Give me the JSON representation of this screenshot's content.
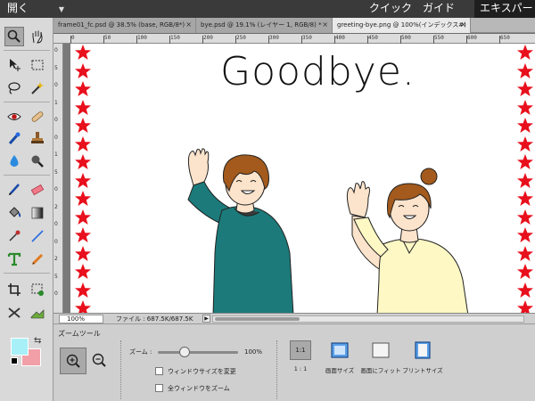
{
  "topbar": {
    "open_label": "開く",
    "modes": {
      "quick": "クイック",
      "guide": "ガイド",
      "expert": "エキスパート"
    }
  },
  "tabs": [
    {
      "label": "frame01_fc.psd @ 38.5% (base, RGB/8*)"
    },
    {
      "label": "bye.psd @ 19.1% (レイヤー 1, RGB/8) *"
    },
    {
      "label": "greeting-bye.png @ 100%(インデックス#)"
    }
  ],
  "ruler": {
    "h_marks": [
      "0",
      "50",
      "100",
      "150",
      "200",
      "250",
      "300",
      "350",
      "400",
      "450",
      "500",
      "550",
      "600",
      "650"
    ],
    "v_marks": [
      "0",
      "5",
      "0",
      "1",
      "0",
      "0",
      "1",
      "5",
      "0",
      "2",
      "0",
      "0",
      "2",
      "5",
      "0"
    ]
  },
  "canvas": {
    "title": "Goodbye.",
    "star_color": "#e8101c"
  },
  "status": {
    "zoom": "100%",
    "file_size": "ファイル : 687.5K/687.5K"
  },
  "colors": {
    "foreground": "#a8f0f8",
    "background": "#f2a0a8"
  },
  "options": {
    "tool_name": "ズームツール",
    "zoom_label": "ズーム :",
    "zoom_value": "100%",
    "zoom_level": 0.33,
    "resize_windows": "ウィンドウサイズを変更",
    "zoom_all_windows": "全ウィンドウをズーム",
    "view_buttons": {
      "actual": "1:1",
      "actual_caption": "1 : 1",
      "screen": "画面サイズ",
      "fit": "画面にフィット",
      "print": "プリントサイズ"
    }
  }
}
